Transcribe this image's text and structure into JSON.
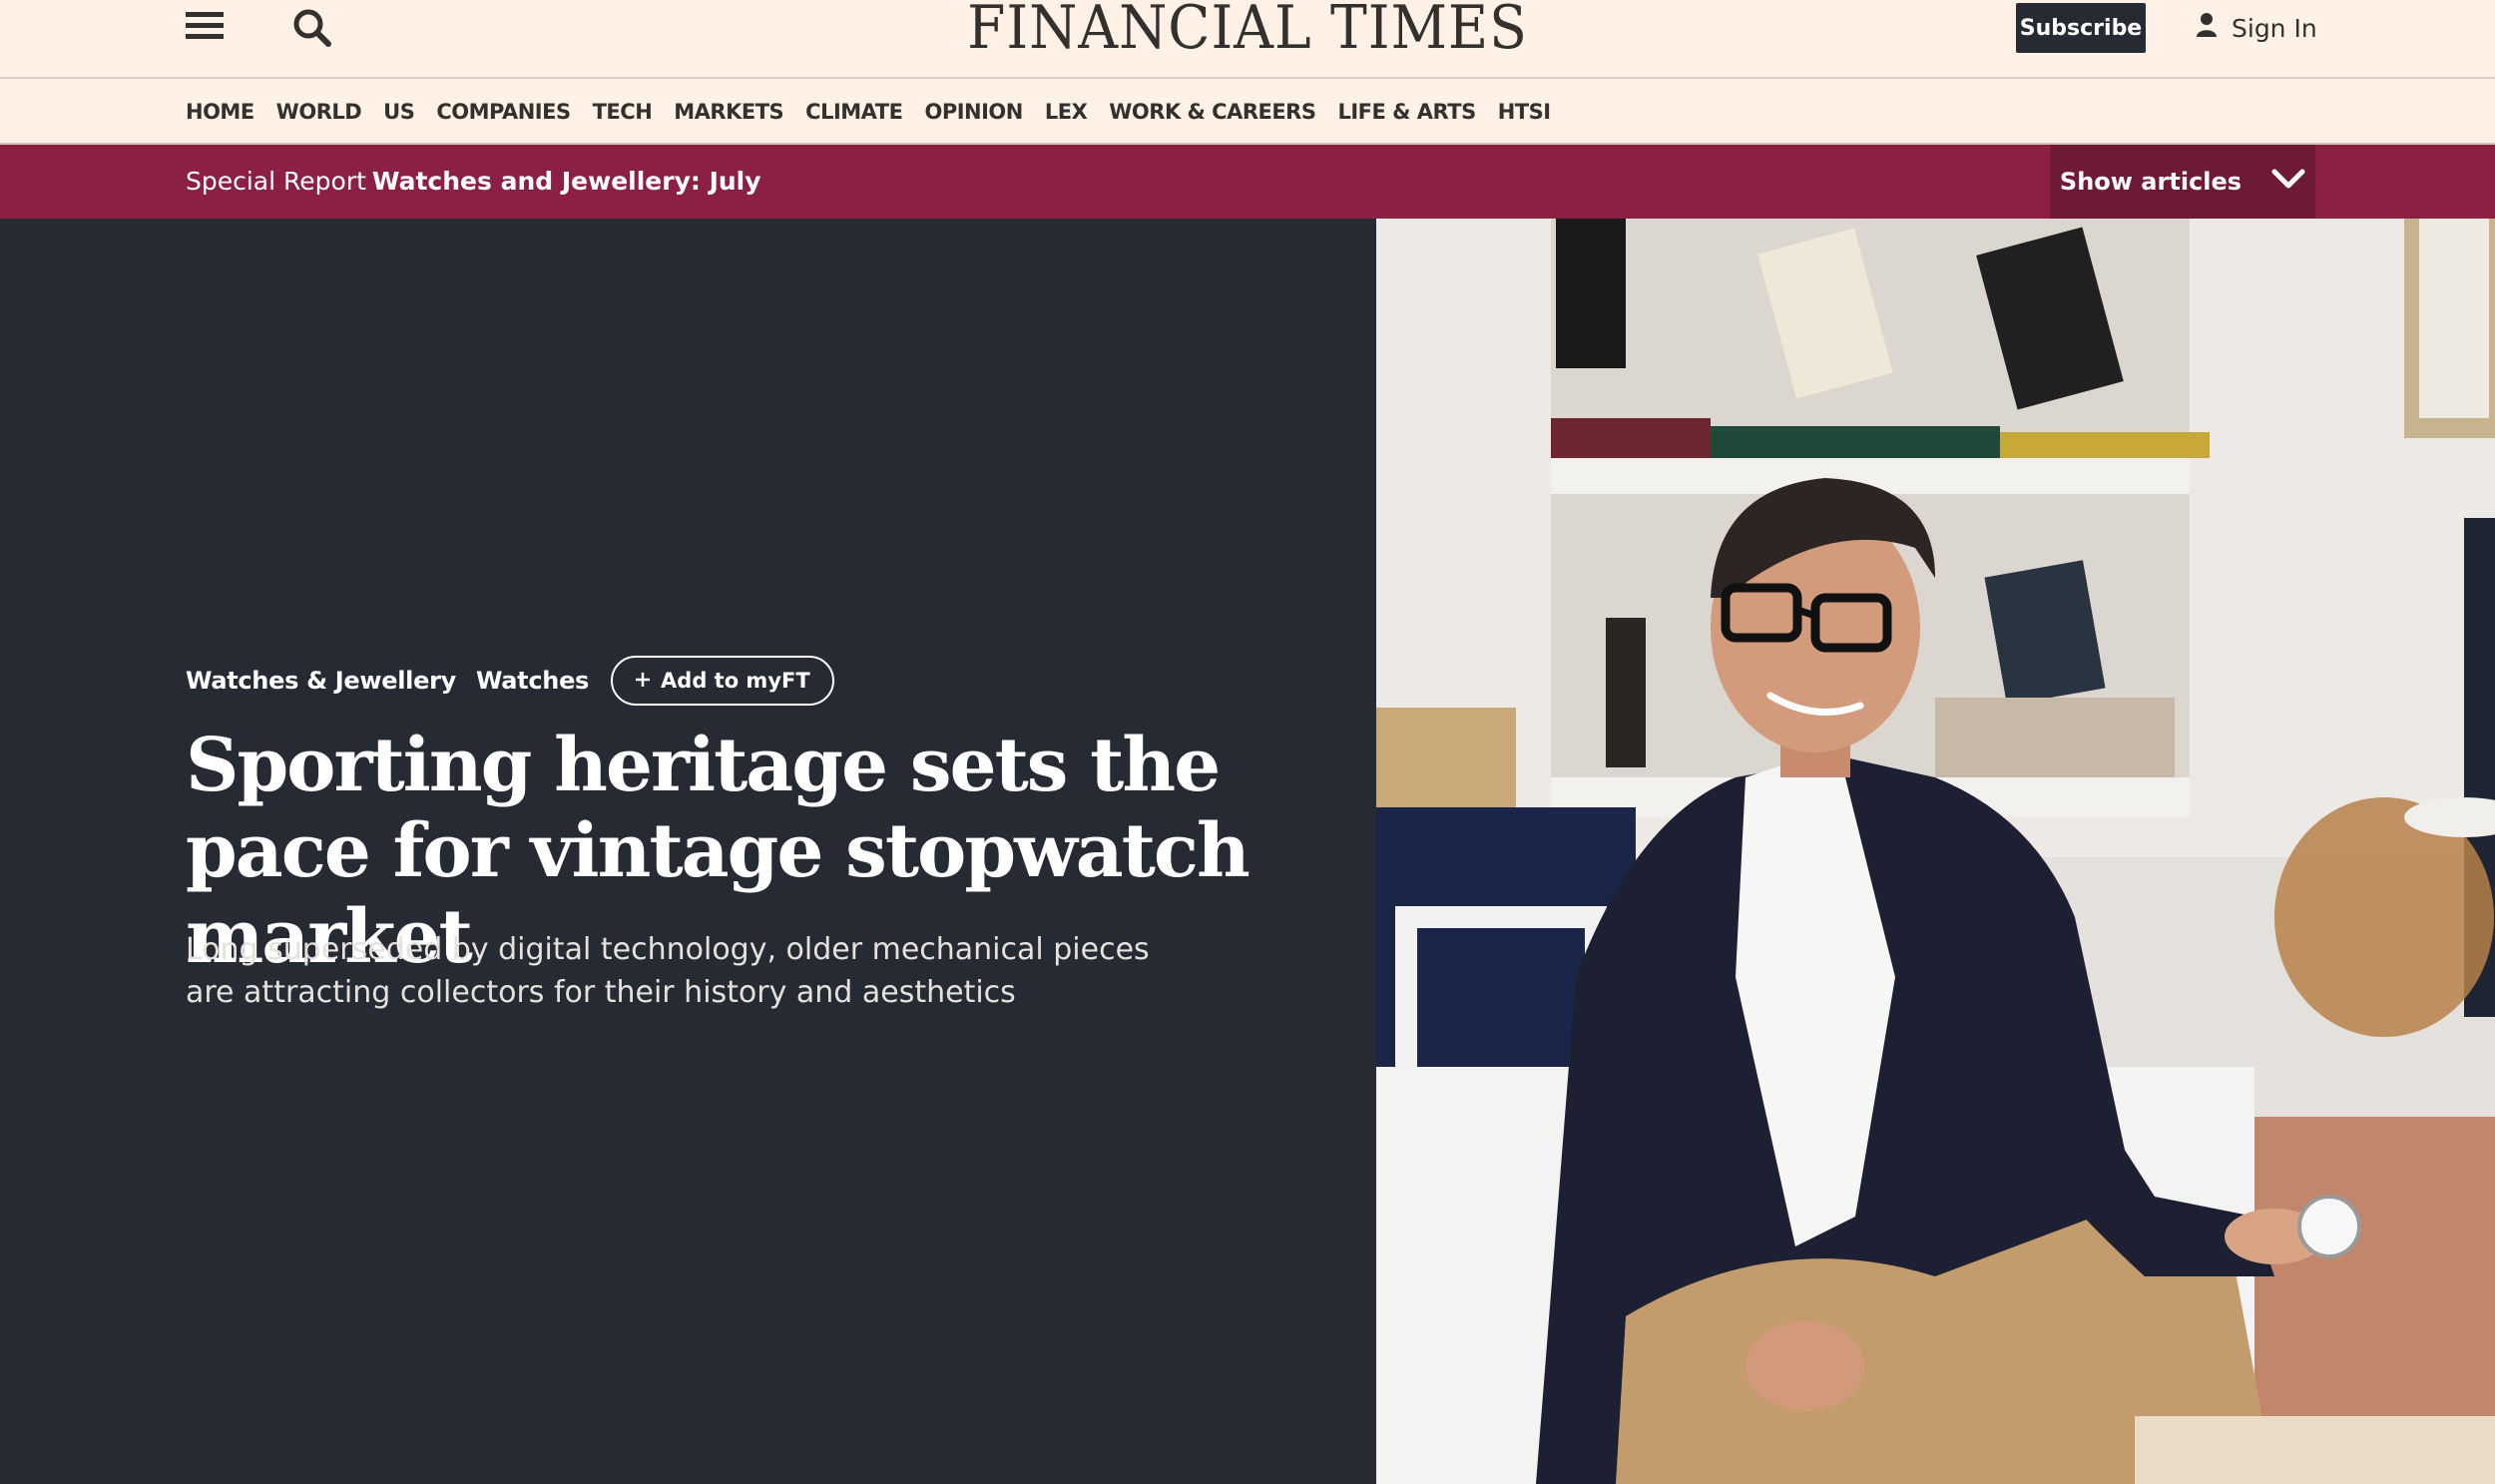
{
  "header": {
    "logo": "FINANCIAL TIMES",
    "subscribe_label": "Subscribe",
    "signin_label": "Sign In"
  },
  "nav": {
    "items": [
      "HOME",
      "WORLD",
      "US",
      "COMPANIES",
      "TECH",
      "MARKETS",
      "CLIMATE",
      "OPINION",
      "LEX",
      "WORK & CAREERS",
      "LIFE & ARTS",
      "HTSI"
    ]
  },
  "special_report": {
    "prefix": "Special Report",
    "title": "Watches and Jewellery: July",
    "show_articles_label": "Show articles"
  },
  "article": {
    "tags": [
      "Watches & Jewellery",
      "Watches"
    ],
    "add_myft_label": "Add to myFT",
    "headline": "Sporting heritage sets the pace for vintage stopwatch market",
    "standfirst": "Long superseded by digital technology, older mechanical pieces are attracting collectors for their history and aesthetics"
  },
  "colors": {
    "header_bg": "#fff1e5",
    "report_bar": "#8b2042",
    "hero_bg": "#262a33",
    "text_dark": "#33302e"
  },
  "icons": [
    "hamburger-menu-icon",
    "search-icon",
    "user-icon",
    "chevron-down-icon",
    "plus-icon"
  ]
}
